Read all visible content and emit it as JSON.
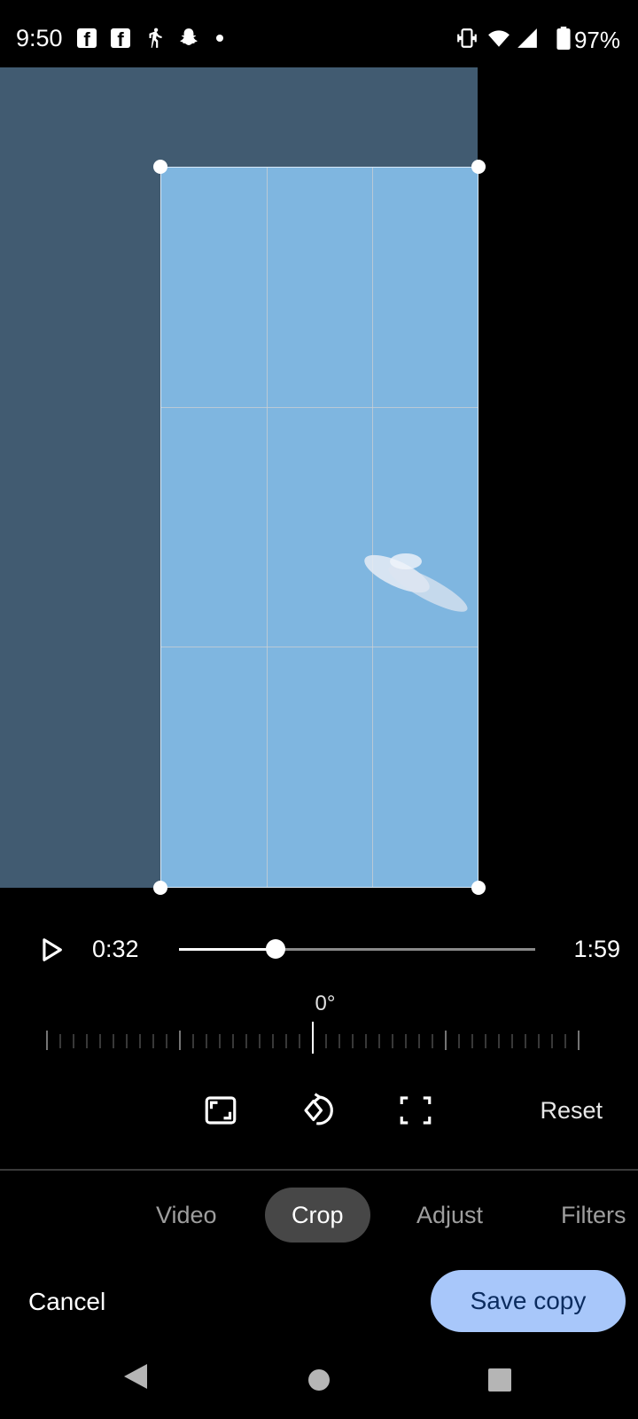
{
  "status_bar": {
    "time": "9:50",
    "battery": "97%",
    "left_icons": [
      "facebook-icon",
      "facebook-icon",
      "walking-icon",
      "snapchat-icon",
      "dot-icon"
    ],
    "right_icons": [
      "vibrate-icon",
      "wifi-icon",
      "signal-icon",
      "battery-icon"
    ]
  },
  "player": {
    "current_time": "0:32",
    "total_time": "1:59",
    "progress": 0.27
  },
  "rotation": {
    "value": "0°"
  },
  "tools": {
    "icons": [
      "aspect-ratio-icon",
      "rotate-icon",
      "free-crop-icon"
    ],
    "reset_label": "Reset"
  },
  "tabs": [
    {
      "label": "Video",
      "active": false
    },
    {
      "label": "Crop",
      "active": true
    },
    {
      "label": "Adjust",
      "active": false
    },
    {
      "label": "Filters",
      "active": false
    }
  ],
  "actions": {
    "cancel_label": "Cancel",
    "save_label": "Save copy"
  },
  "colors": {
    "accent": "#a8c7fa",
    "crop_image": "#7fb6e0",
    "dimmed_image": "#415b71"
  },
  "nav_bar": [
    "back-icon",
    "home-icon",
    "recents-icon"
  ]
}
